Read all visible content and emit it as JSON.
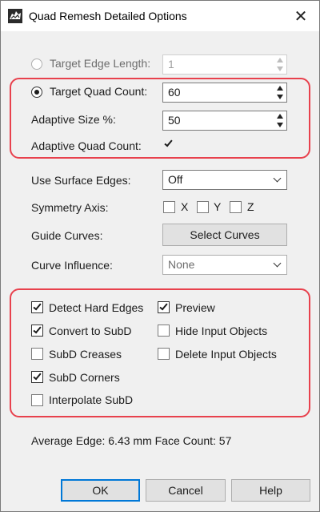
{
  "window": {
    "title": "Quad Remesh Detailed Options"
  },
  "params": {
    "target_edge_length": {
      "label": "Target Edge Length:",
      "value": "1"
    },
    "target_quad_count": {
      "label": "Target Quad Count:",
      "value": "60"
    },
    "adaptive_size": {
      "label": "Adaptive Size %:",
      "value": "50"
    },
    "adaptive_quad_count": {
      "label": "Adaptive Quad Count:"
    }
  },
  "surface": {
    "use_surface_edges": {
      "label": "Use Surface Edges:",
      "value": "Off"
    },
    "symmetry_axis": {
      "label": "Symmetry Axis:",
      "x": "X",
      "y": "Y",
      "z": "Z"
    },
    "guide_curves": {
      "label": "Guide Curves:",
      "button": "Select Curves"
    },
    "curve_influence": {
      "label": "Curve Influence:",
      "value": "None"
    }
  },
  "options": {
    "detect_hard_edges": "Detect Hard Edges",
    "preview": "Preview",
    "convert_to_subd": "Convert to SubD",
    "hide_input_objects": "Hide Input Objects",
    "subd_creases": "SubD Creases",
    "delete_input_objects": "Delete Input Objects",
    "subd_corners": "SubD Corners",
    "interpolate_subd": "Interpolate SubD"
  },
  "status": {
    "average_edge_label": "Average Edge:",
    "average_edge_value": "6.43 mm",
    "face_count_label": "Face Count:",
    "face_count_value": "57"
  },
  "buttons": {
    "ok": "OK",
    "cancel": "Cancel",
    "help": "Help"
  },
  "colors": {
    "highlight": "#e8414d",
    "accent": "#0078d7"
  }
}
